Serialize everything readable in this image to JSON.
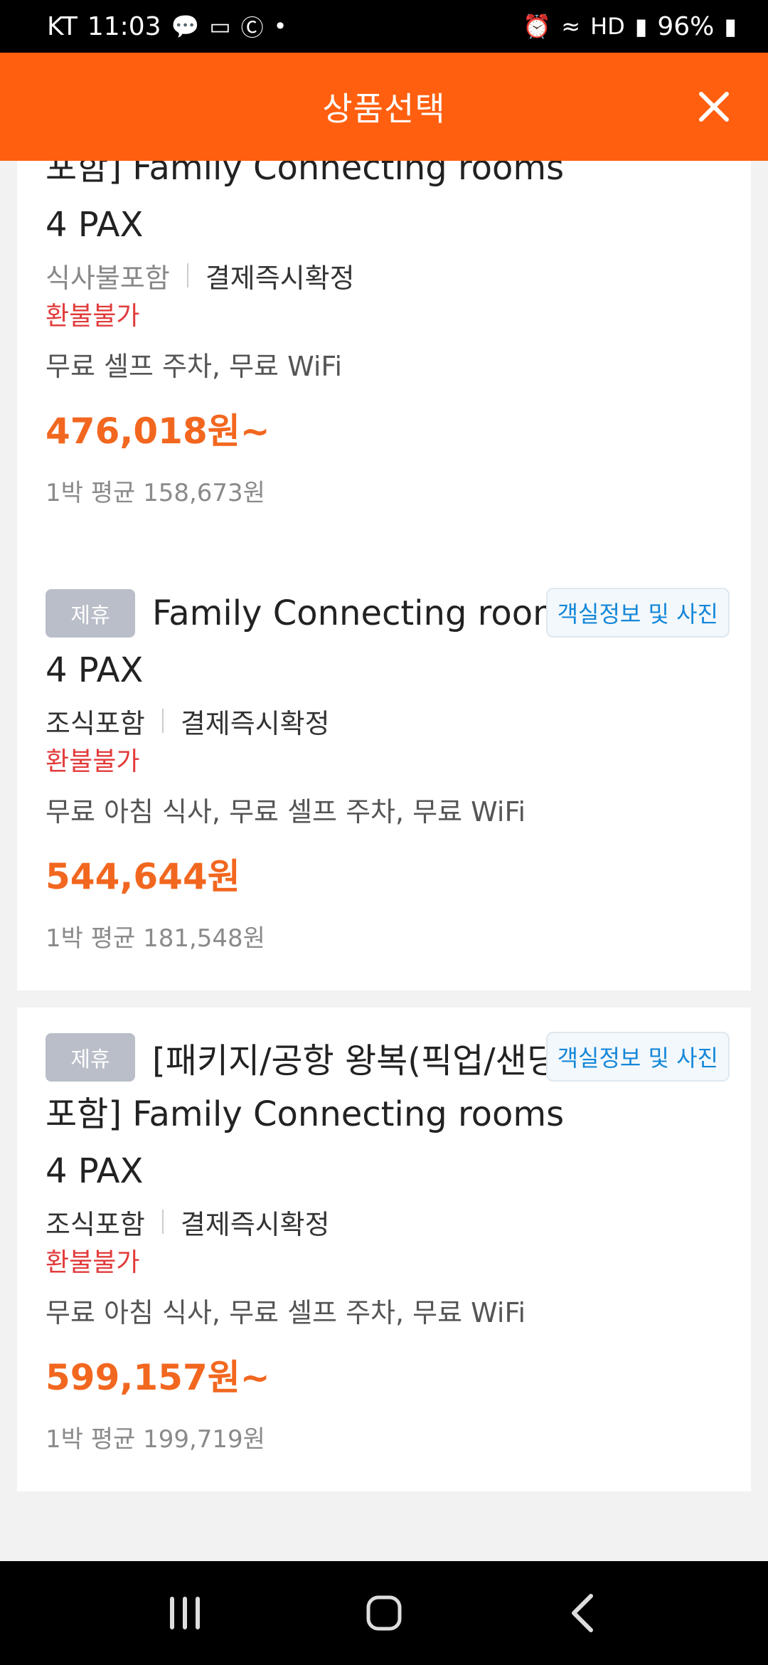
{
  "status_bar": {
    "carrier": "KT",
    "time": "11:03",
    "battery": "96%"
  },
  "header": {
    "title": "상품선택"
  },
  "cards": [
    {
      "title_lines": [
        "포함] Family Connecting rooms",
        "4 PAX"
      ],
      "meal": "식사불포함",
      "payment": "결제즉시확정",
      "refund": "환불불가",
      "amenities": "무료 셀프 주차, 무료 WiFi",
      "price": "476,018원~",
      "average": "1박 평균 158,673원"
    },
    {
      "badge": "제휴",
      "title": "Family Connecting rooms",
      "title_line_2": "4 PAX",
      "info_button": "객실정보 및 사진",
      "meal": "조식포함",
      "payment": "결제즉시확정",
      "refund": "환불불가",
      "amenities": "무료 아침 식사, 무료 셀프 주차, 무료 WiFi",
      "price": "544,644원",
      "average": "1박 평균 181,548원"
    },
    {
      "badge": "제휴",
      "title": "[패키지/공항 왕복(픽업/샌딩)",
      "title_line_2": "포함] Family Connecting rooms",
      "title_line_3": "4 PAX",
      "info_button": "객실정보 및 사진",
      "meal": "조식포함",
      "payment": "결제즉시확정",
      "refund": "환불불가",
      "amenities": "무료 아침 식사, 무료 셀프 주차, 무료 WiFi",
      "price": "599,157원~",
      "average": "1박 평균 199,719원"
    }
  ],
  "icons": {
    "close": "close-icon",
    "nav_recent": "recent-apps-icon",
    "nav_home": "home-icon",
    "nav_back": "back-icon"
  }
}
